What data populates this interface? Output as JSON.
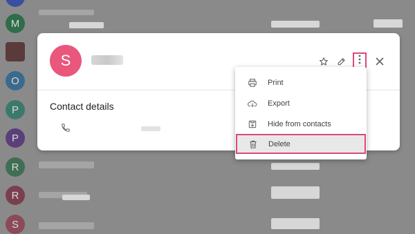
{
  "background_list": {
    "avatars": [
      {
        "letter": "",
        "color": "#3a4fa0"
      },
      {
        "letter": "M",
        "color": "#2f6c4a"
      },
      {
        "letter": "",
        "color": "#5a3a3a"
      },
      {
        "letter": "O",
        "color": "#3a6a8e"
      },
      {
        "letter": "P",
        "color": "#3b7a6a"
      },
      {
        "letter": "P",
        "color": "#5a3f7a"
      },
      {
        "letter": "R",
        "color": "#3f6e55"
      },
      {
        "letter": "R",
        "color": "#7a3f4f"
      },
      {
        "letter": "S",
        "color": "#8a4a5a"
      }
    ]
  },
  "contact_card": {
    "avatar_letter": "S",
    "avatar_color": "#e9577d",
    "section_title": "Contact details",
    "icons": [
      "star-icon",
      "pencil-icon",
      "more-vert-icon",
      "close-icon",
      "phone-icon"
    ]
  },
  "menu": {
    "items": [
      {
        "label": "Print",
        "icon": "print-icon"
      },
      {
        "label": "Export",
        "icon": "cloud-download-icon"
      },
      {
        "label": "Hide from contacts",
        "icon": "hide-contact-icon"
      },
      {
        "label": "Delete",
        "icon": "trash-icon"
      }
    ]
  },
  "highlight_color": "#e0457b"
}
